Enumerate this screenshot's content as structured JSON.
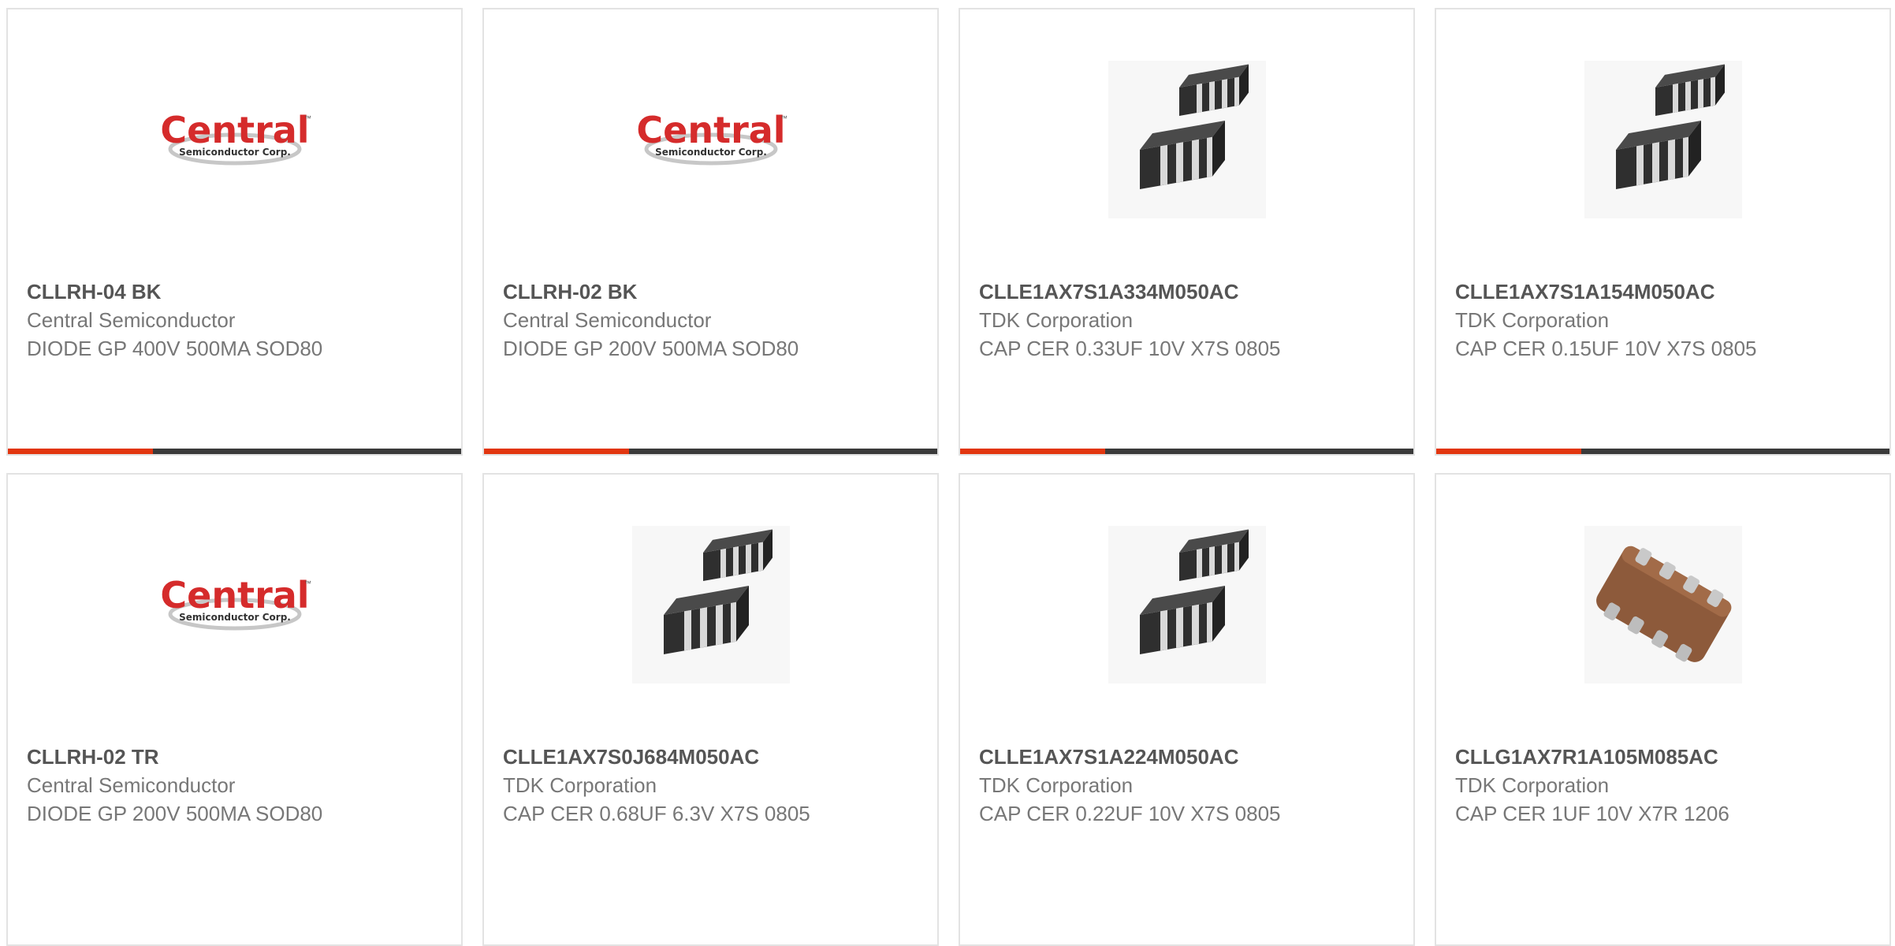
{
  "colors": {
    "accent": "#e2360f",
    "bar_track": "#3a3a3a",
    "card_border": "#e3e3e3",
    "title_text": "#555555",
    "body_text": "#777777"
  },
  "products": [
    {
      "part_number": "CLLRH-04 BK",
      "manufacturer": "Central Semiconductor",
      "description": "DIODE GP 400V 500MA SOD80",
      "image": "central-semiconductor-logo",
      "progress": 0.32
    },
    {
      "part_number": "CLLRH-02 BK",
      "manufacturer": "Central Semiconductor",
      "description": "DIODE GP 200V 500MA SOD80",
      "image": "central-semiconductor-logo",
      "progress": 0.32
    },
    {
      "part_number": "CLLE1AX7S1A334M050AC",
      "manufacturer": "TDK Corporation",
      "description": "CAP CER 0.33UF 10V X7S 0805",
      "image": "capacitor-array-pair",
      "progress": 0.32
    },
    {
      "part_number": "CLLE1AX7S1A154M050AC",
      "manufacturer": "TDK Corporation",
      "description": "CAP CER 0.15UF 10V X7S 0805",
      "image": "capacitor-array-pair",
      "progress": 0.32
    },
    {
      "part_number": "CLLRH-02 TR",
      "manufacturer": "Central Semiconductor",
      "description": "DIODE GP 200V 500MA SOD80",
      "image": "central-semiconductor-logo"
    },
    {
      "part_number": "CLLE1AX7S0J684M050AC",
      "manufacturer": "TDK Corporation",
      "description": "CAP CER 0.68UF 6.3V X7S 0805",
      "image": "capacitor-array-pair"
    },
    {
      "part_number": "CLLE1AX7S1A224M050AC",
      "manufacturer": "TDK Corporation",
      "description": "CAP CER 0.22UF 10V X7S 0805",
      "image": "capacitor-array-pair"
    },
    {
      "part_number": "CLLG1AX7R1A105M085AC",
      "manufacturer": "TDK Corporation",
      "description": "CAP CER 1UF 10V X7R 1206",
      "image": "brown-capacitor-chip"
    }
  ],
  "logo": {
    "wordmark": "Central",
    "tagline": "Semiconductor Corp.",
    "tm": "™"
  }
}
